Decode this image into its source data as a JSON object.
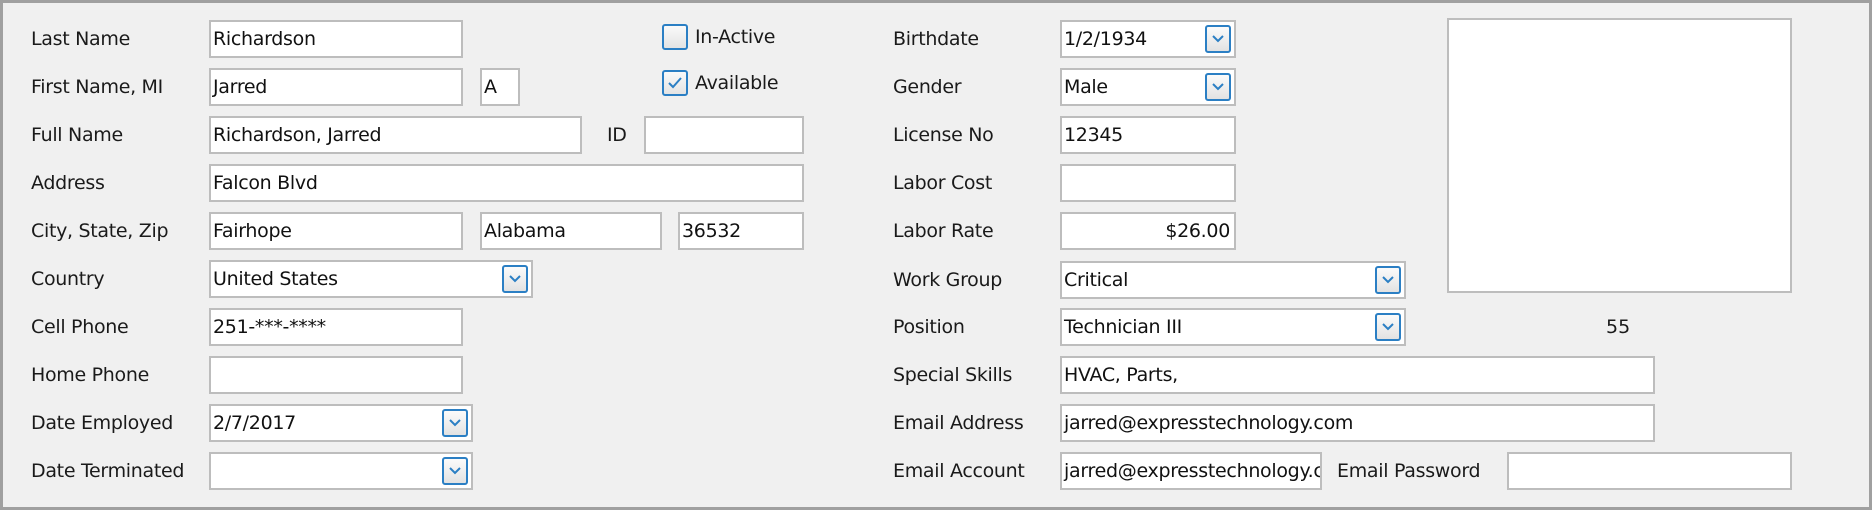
{
  "left": {
    "last_name": {
      "label": "Last Name",
      "value": "Richardson"
    },
    "first_name": {
      "label": "First Name, MI",
      "value": "Jarred",
      "mi": "A"
    },
    "full_name": {
      "label": "Full Name",
      "value": "Richardson, Jarred"
    },
    "id": {
      "label": "ID",
      "value": ""
    },
    "address": {
      "label": "Address",
      "value": "Falcon Blvd"
    },
    "city_state_zip": {
      "label": "City, State, Zip",
      "city": "Fairhope",
      "state": "Alabama",
      "zip": "36532"
    },
    "country": {
      "label": "Country",
      "value": "United States"
    },
    "cell_phone": {
      "label": "Cell Phone",
      "value": "251-***-****"
    },
    "home_phone": {
      "label": "Home Phone",
      "value": ""
    },
    "date_employed": {
      "label": "Date Employed",
      "value": "2/7/2017"
    },
    "date_terminated": {
      "label": "Date Terminated",
      "value": ""
    }
  },
  "checkboxes": {
    "inactive": {
      "label": "In-Active",
      "checked": false
    },
    "available": {
      "label": "Available",
      "checked": true
    }
  },
  "right": {
    "birthdate": {
      "label": "Birthdate",
      "value": "1/2/1934"
    },
    "gender": {
      "label": "Gender",
      "value": "Male"
    },
    "license_no": {
      "label": "License No",
      "value": "12345"
    },
    "labor_cost": {
      "label": "Labor Cost",
      "value": ""
    },
    "labor_rate": {
      "label": "Labor Rate",
      "value": "$26.00"
    },
    "work_group": {
      "label": "Work Group",
      "value": "Critical"
    },
    "position": {
      "label": "Position",
      "value": "Technician III"
    },
    "special_skills": {
      "label": "Special Skills",
      "value": "HVAC, Parts,"
    },
    "email_address": {
      "label": "Email Address",
      "value": "jarred@expresstechnology.com"
    },
    "email_account": {
      "label": "Email Account",
      "value": "jarred@expresstechnology.com"
    },
    "email_password": {
      "label": "Email Password",
      "value": ""
    }
  },
  "photo_counter": "55",
  "colors": {
    "accent": "#2b7fc4",
    "border": "#bdbdbd",
    "background": "#f0f0f0"
  }
}
